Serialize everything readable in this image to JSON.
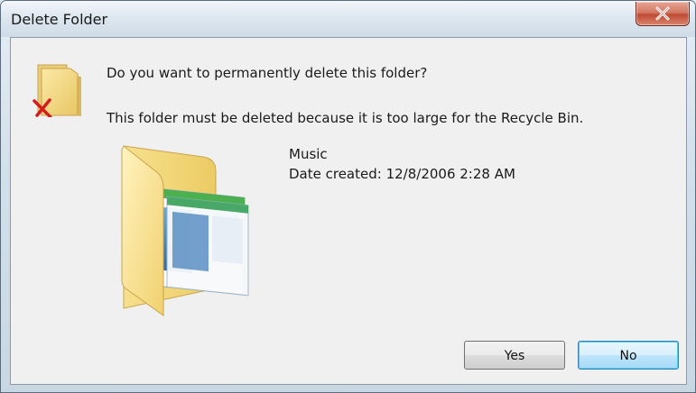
{
  "window": {
    "title": "Delete Folder",
    "close_icon": "close-icon"
  },
  "dialog": {
    "main_instruction": "Do you want to permanently delete this folder?",
    "detail": "This folder must be deleted because it is too large for the Recycle Bin.",
    "item": {
      "name": "Music",
      "date_created": "Date created: 12/8/2006 2:28 AM"
    },
    "icons": {
      "warning": "folder-delete-icon",
      "preview": "folder-icon"
    }
  },
  "buttons": {
    "yes_label": "Yes",
    "no_label": "No"
  },
  "colors": {
    "close_button": "#c04b35",
    "default_button_border": "#3c7fb1"
  }
}
